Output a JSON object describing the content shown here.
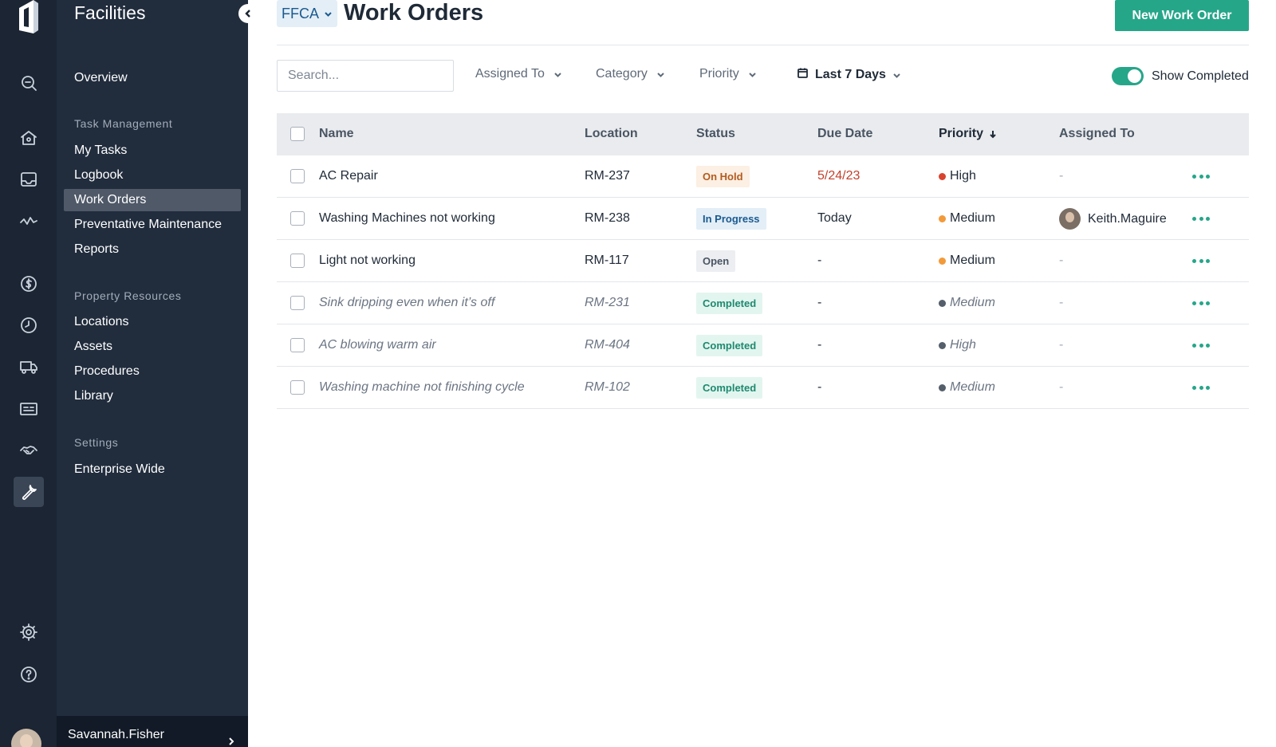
{
  "app": {
    "section_title": "Facilities"
  },
  "rail": {
    "icons": [
      "logo-icon",
      "search-icon",
      "home-icon",
      "inbox-icon",
      "activity-icon",
      "dollar-icon",
      "clock-icon",
      "truck-icon",
      "id-card-icon",
      "handshake-icon",
      "wrench-icon",
      "gear-icon",
      "help-icon"
    ],
    "active": "wrench-icon"
  },
  "sidebar": {
    "overview": "Overview",
    "sections": [
      {
        "label": "Task Management",
        "items": [
          "My Tasks",
          "Logbook",
          "Work Orders",
          "Preventative Maintenance",
          "Reports"
        ]
      },
      {
        "label": "Property Resources",
        "items": [
          "Locations",
          "Assets",
          "Procedures",
          "Library"
        ]
      },
      {
        "label": "Settings",
        "items": [
          "Enterprise Wide"
        ]
      }
    ],
    "active_item": "Work Orders",
    "user_name": "Savannah.Fisher"
  },
  "header": {
    "org": "FFCA",
    "title": "Work Orders",
    "new_button": "New Work Order"
  },
  "filters": {
    "search_placeholder": "Search...",
    "assigned_to": "Assigned To",
    "category": "Category",
    "priority": "Priority",
    "date_range": "Last 7 Days",
    "show_completed_label": "Show Completed",
    "show_completed": true
  },
  "table": {
    "columns": [
      "Name",
      "Location",
      "Status",
      "Due Date",
      "Priority",
      "Assigned To"
    ],
    "sorted_column": "Priority",
    "rows": [
      {
        "name": "AC Repair",
        "location": "RM-237",
        "status": "On Hold",
        "due": "5/24/23",
        "priority": "High",
        "assigned": "-",
        "completed": false
      },
      {
        "name": "Washing Machines not working",
        "location": "RM-238",
        "status": "In Progress",
        "due": "Today",
        "priority": "Medium",
        "assigned": "Keith.Maguire",
        "completed": false
      },
      {
        "name": "Light not working",
        "location": "RM-117",
        "status": "Open",
        "due": "-",
        "priority": "Medium",
        "assigned": "-",
        "completed": false
      },
      {
        "name": "Sink dripping even when it’s off",
        "location": "RM-231",
        "status": "Completed",
        "due": "-",
        "priority": "Medium",
        "assigned": "-",
        "completed": true
      },
      {
        "name": "AC blowing warm air",
        "location": "RM-404",
        "status": "Completed",
        "due": "-",
        "priority": "High",
        "assigned": "-",
        "completed": true
      },
      {
        "name": "Washing machine not finishing cycle",
        "location": "RM-102",
        "status": "Completed",
        "due": "-",
        "priority": "Medium",
        "assigned": "-",
        "completed": true
      }
    ]
  },
  "colors": {
    "accent": "#26a689",
    "priority_high": "#d8442f",
    "priority_medium": "#f29a3a",
    "priority_completed": "#555f6b",
    "due_overdue": "#c2402c"
  }
}
